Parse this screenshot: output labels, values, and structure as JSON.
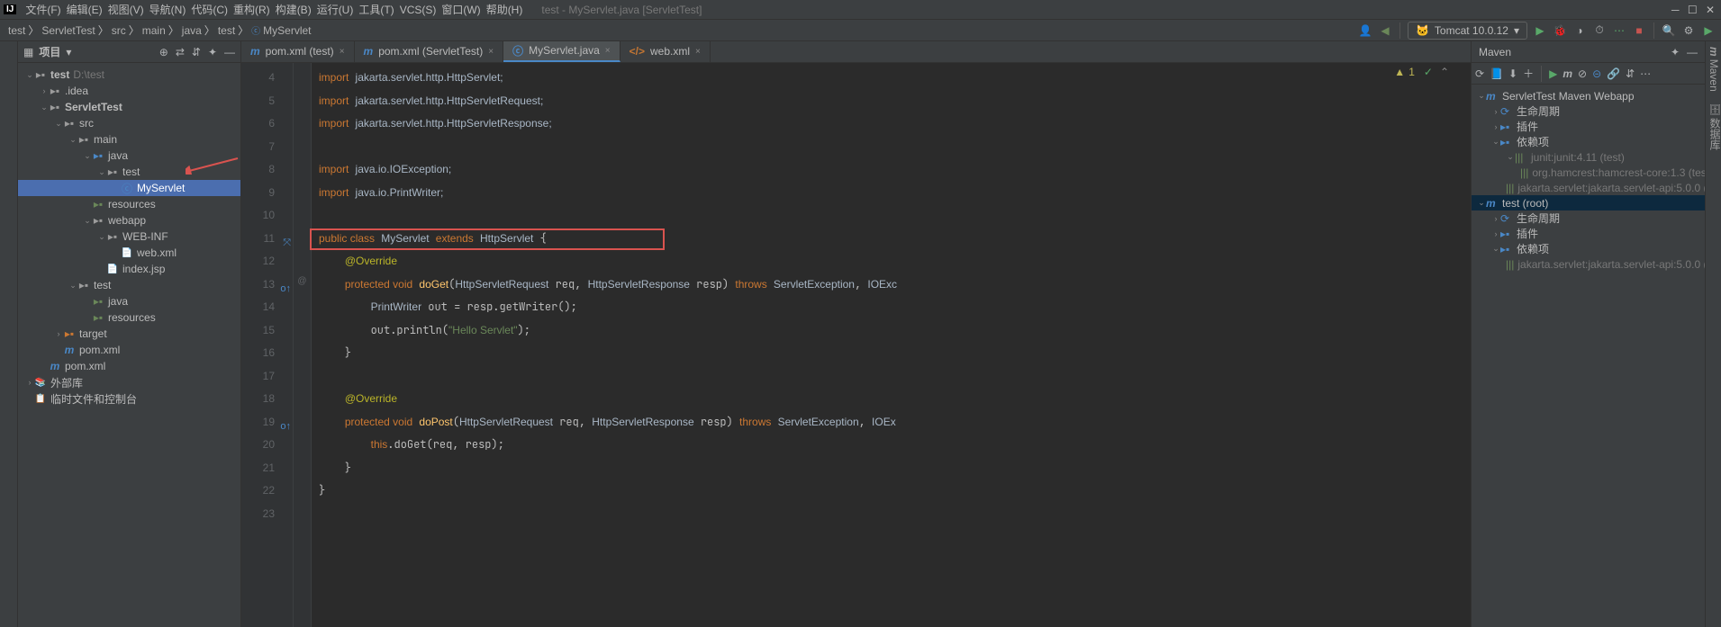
{
  "window": {
    "title": "test - MyServlet.java [ServletTest]"
  },
  "menu": [
    "文件(F)",
    "编辑(E)",
    "视图(V)",
    "导航(N)",
    "代码(C)",
    "重构(R)",
    "构建(B)",
    "运行(U)",
    "工具(T)",
    "VCS(S)",
    "窗口(W)",
    "帮助(H)"
  ],
  "breadcrumbs": [
    "test",
    "ServletTest",
    "src",
    "main",
    "java",
    "test",
    "MyServlet"
  ],
  "run_config": "Tomcat 10.0.12",
  "project": {
    "title": "项目",
    "root": {
      "name": "test",
      "path": "D:\\test"
    },
    "tree": [
      {
        "d": 0,
        "a": "v",
        "icon": "folder",
        "label": "test",
        "dim": "D:\\test",
        "bold": true
      },
      {
        "d": 1,
        "a": ">",
        "icon": "folder",
        "label": ".idea"
      },
      {
        "d": 1,
        "a": "v",
        "icon": "folder",
        "label": "ServletTest",
        "bold": true
      },
      {
        "d": 2,
        "a": "v",
        "icon": "folder",
        "label": "src"
      },
      {
        "d": 3,
        "a": "v",
        "icon": "folder",
        "label": "main"
      },
      {
        "d": 4,
        "a": "v",
        "icon": "folder blue",
        "label": "java"
      },
      {
        "d": 5,
        "a": "v",
        "icon": "folder",
        "label": "test"
      },
      {
        "d": 6,
        "a": "",
        "icon": "class",
        "label": "MyServlet",
        "sel": true
      },
      {
        "d": 4,
        "a": "",
        "icon": "folder green",
        "label": "resources"
      },
      {
        "d": 4,
        "a": "v",
        "icon": "folder",
        "label": "webapp"
      },
      {
        "d": 5,
        "a": "v",
        "icon": "folder",
        "label": "WEB-INF"
      },
      {
        "d": 6,
        "a": "",
        "icon": "xml",
        "label": "web.xml"
      },
      {
        "d": 5,
        "a": "",
        "icon": "jsp",
        "label": "index.jsp"
      },
      {
        "d": 3,
        "a": "v",
        "icon": "folder",
        "label": "test"
      },
      {
        "d": 4,
        "a": "",
        "icon": "folder green",
        "label": "java"
      },
      {
        "d": 4,
        "a": "",
        "icon": "folder green",
        "label": "resources"
      },
      {
        "d": 2,
        "a": ">",
        "icon": "folder orange",
        "label": "target"
      },
      {
        "d": 2,
        "a": "",
        "icon": "maven",
        "label": "pom.xml"
      },
      {
        "d": 1,
        "a": "",
        "icon": "maven",
        "label": "pom.xml"
      },
      {
        "d": 0,
        "a": ">",
        "icon": "lib",
        "label": "外部库"
      },
      {
        "d": 0,
        "a": "",
        "icon": "scratch",
        "label": "临时文件和控制台"
      }
    ]
  },
  "tabs": [
    {
      "icon": "m",
      "label": "pom.xml (test)",
      "active": false
    },
    {
      "icon": "m",
      "label": "pom.xml (ServletTest)",
      "active": false
    },
    {
      "icon": "c",
      "label": "MyServlet.java",
      "active": true
    },
    {
      "icon": "x",
      "label": "web.xml",
      "active": false
    }
  ],
  "warnings": {
    "triangle": "1",
    "check": "✓"
  },
  "code_start": 4,
  "code_lines": [
    {
      "n": 4,
      "html": "<span class='kw'>import</span> <span class='ident'>jakarta.servlet.http.HttpServlet;</span>"
    },
    {
      "n": 5,
      "html": "<span class='kw'>import</span> <span class='ident'>jakarta.servlet.http.HttpServletRequest;</span>"
    },
    {
      "n": 6,
      "html": "<span class='kw'>import</span> <span class='ident'>jakarta.servlet.http.HttpServletResponse;</span>"
    },
    {
      "n": 7,
      "html": ""
    },
    {
      "n": 8,
      "html": "<span class='kw'>import</span> <span class='ident'>java.io.IOException;</span>"
    },
    {
      "n": 9,
      "html": "<span class='kw'>import</span> <span class='ident'>java.io.PrintWriter;</span>"
    },
    {
      "n": 10,
      "html": ""
    },
    {
      "n": 11,
      "html": "<span class='kw'>public class</span> <span class='type'>MyServlet</span> <span class='kw'>extends</span> <span class='type'>HttpServlet</span> {",
      "g1": "⤧"
    },
    {
      "n": 12,
      "html": "    <span class='ann'>@Override</span>"
    },
    {
      "n": 13,
      "html": "    <span class='kw'>protected void</span> <span class='method'>doGet</span>(<span class='type'>HttpServletRequest</span> req, <span class='type'>HttpServletResponse</span> resp) <span class='kw'>throws</span> <span class='type'>ServletException</span>, <span class='type'>IOExc</span>",
      "g1": "o↑",
      "g2": "@"
    },
    {
      "n": 14,
      "html": "        <span class='type'>PrintWriter</span> out = resp.getWriter();"
    },
    {
      "n": 15,
      "html": "        out.println(<span class='str'>\"Hello Servlet\"</span>);"
    },
    {
      "n": 16,
      "html": "    }"
    },
    {
      "n": 17,
      "html": ""
    },
    {
      "n": 18,
      "html": "    <span class='ann'>@Override</span>"
    },
    {
      "n": 19,
      "html": "    <span class='kw'>protected void</span> <span class='method'>doPost</span>(<span class='type'>HttpServletRequest</span> req, <span class='type'>HttpServletResponse</span> resp) <span class='kw'>throws</span> <span class='type'>ServletException</span>, <span class='type'>IOEx</span>",
      "g1": "o↑"
    },
    {
      "n": 20,
      "html": "        <span class='kw'>this</span>.doGet(req, resp);"
    },
    {
      "n": 21,
      "html": "    }"
    },
    {
      "n": 22,
      "html": "}"
    },
    {
      "n": 23,
      "html": ""
    }
  ],
  "maven": {
    "title": "Maven",
    "tree": [
      {
        "d": 0,
        "a": "v",
        "icon": "m",
        "label": "ServletTest Maven Webapp"
      },
      {
        "d": 1,
        "a": ">",
        "icon": "cycle",
        "label": "生命周期"
      },
      {
        "d": 1,
        "a": ">",
        "icon": "plug",
        "label": "插件"
      },
      {
        "d": 1,
        "a": "v",
        "icon": "dep",
        "label": "依赖项"
      },
      {
        "d": 2,
        "a": "v",
        "icon": "lib",
        "label": "junit:junit:4.11 (test)",
        "dim": true
      },
      {
        "d": 3,
        "a": "",
        "icon": "lib",
        "label": "org.hamcrest:hamcrest-core:1.3 (tes",
        "dim": true
      },
      {
        "d": 2,
        "a": "",
        "icon": "lib",
        "label": "jakarta.servlet:jakarta.servlet-api:5.0.0 (",
        "dim": true
      },
      {
        "d": 0,
        "a": "v",
        "icon": "m",
        "label": "test (root)",
        "sel": true
      },
      {
        "d": 1,
        "a": ">",
        "icon": "cycle",
        "label": "生命周期"
      },
      {
        "d": 1,
        "a": ">",
        "icon": "plug",
        "label": "插件"
      },
      {
        "d": 1,
        "a": "v",
        "icon": "dep",
        "label": "依赖项"
      },
      {
        "d": 2,
        "a": "",
        "icon": "lib",
        "label": "jakarta.servlet:jakarta.servlet-api:5.0.0 (",
        "dim": true
      }
    ]
  },
  "right_strip": [
    "Maven",
    "数据库"
  ]
}
